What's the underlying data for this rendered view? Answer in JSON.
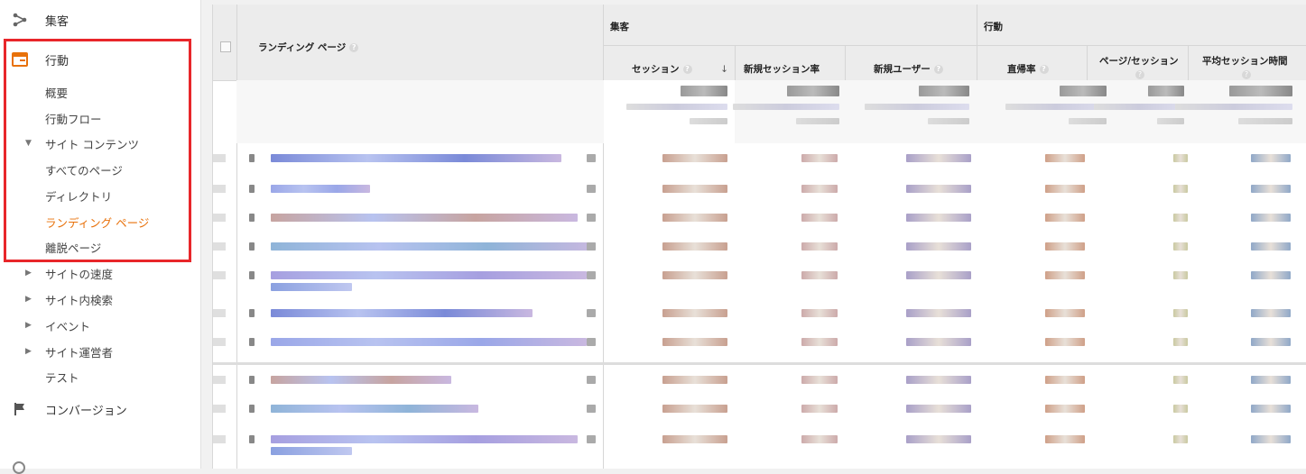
{
  "nav": {
    "acquisition": "集客",
    "behavior": "行動",
    "conversion": "コンバージョン"
  },
  "behavior_items": [
    {
      "label": "概要",
      "active": false,
      "toggle": false
    },
    {
      "label": "行動フロー",
      "active": false,
      "toggle": false
    },
    {
      "label": "サイト コンテンツ",
      "active": false,
      "toggle": true
    },
    {
      "label": "すべてのページ",
      "active": false,
      "toggle": false
    },
    {
      "label": "ディレクトリ",
      "active": false,
      "toggle": false
    },
    {
      "label": "ランディング ページ",
      "active": true,
      "toggle": false
    },
    {
      "label": "離脱ページ",
      "active": false,
      "toggle": false
    }
  ],
  "other_items": [
    {
      "label": "サイトの速度",
      "toggle": true
    },
    {
      "label": "サイト内検索",
      "toggle": true
    },
    {
      "label": "イベント",
      "toggle": true
    },
    {
      "label": "サイト運営者",
      "toggle": true
    },
    {
      "label": "テスト",
      "toggle": false
    }
  ],
  "table": {
    "group_acquisition": "集客",
    "group_behavior": "行動",
    "dimension": "ランディング ページ",
    "columns": [
      "セッション",
      "新規セッション率",
      "新規ユーザー",
      "直帰率",
      "ページ/セッション",
      "平均セッション時間"
    ],
    "sort_arrow": "↓",
    "help": "?"
  },
  "colors": {
    "accent": "#e8710a",
    "highlight": "#e8262a",
    "header_bg": "#ececec"
  }
}
